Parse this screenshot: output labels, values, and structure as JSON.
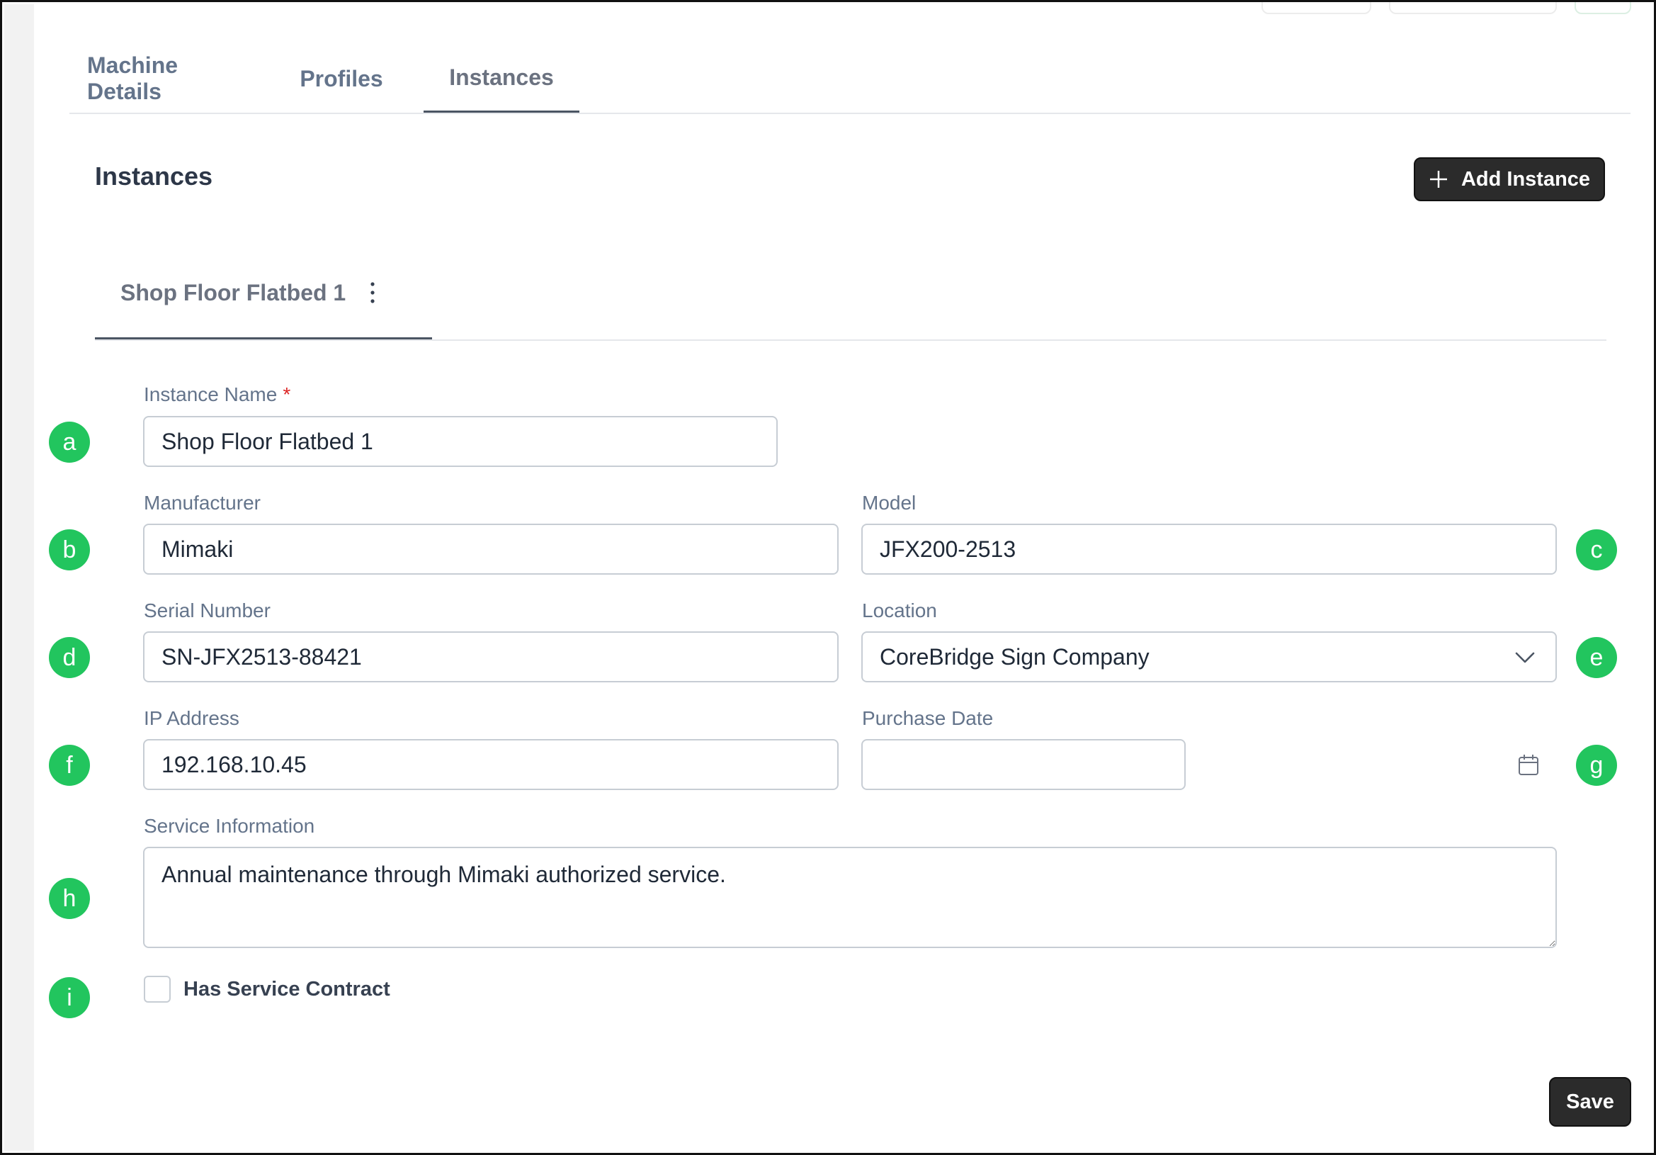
{
  "tabs": [
    {
      "label": "Machine Details"
    },
    {
      "label": "Profiles"
    },
    {
      "label": "Instances"
    }
  ],
  "section": {
    "title": "Instances",
    "add_button_label": "Add Instance"
  },
  "instance_tab": {
    "label": "Shop Floor Flatbed 1",
    "menu_icon": "kebab-icon"
  },
  "form": {
    "instance_name": {
      "label": "Instance Name",
      "required_mark": "*",
      "value": "Shop Floor Flatbed 1"
    },
    "manufacturer": {
      "label": "Manufacturer",
      "value": "Mimaki"
    },
    "model": {
      "label": "Model",
      "value": "JFX200-2513"
    },
    "serial_number": {
      "label": "Serial Number",
      "value": "SN-JFX2513-88421"
    },
    "location": {
      "label": "Location",
      "value": "CoreBridge Sign Company"
    },
    "ip_address": {
      "label": "IP Address",
      "value": "192.168.10.45"
    },
    "purchase_date": {
      "label": "Purchase Date",
      "value": ""
    },
    "service_information": {
      "label": "Service Information",
      "value": "Annual maintenance through Mimaki authorized service."
    },
    "has_service_contract": {
      "label": "Has Service Contract",
      "checked": false
    }
  },
  "markers": [
    "a",
    "b",
    "c",
    "d",
    "e",
    "f",
    "g",
    "h",
    "i"
  ],
  "save_label": "Save",
  "colors": {
    "marker": "#22c55e",
    "primary_button": "#2b2b2b",
    "required": "#dc2626"
  }
}
